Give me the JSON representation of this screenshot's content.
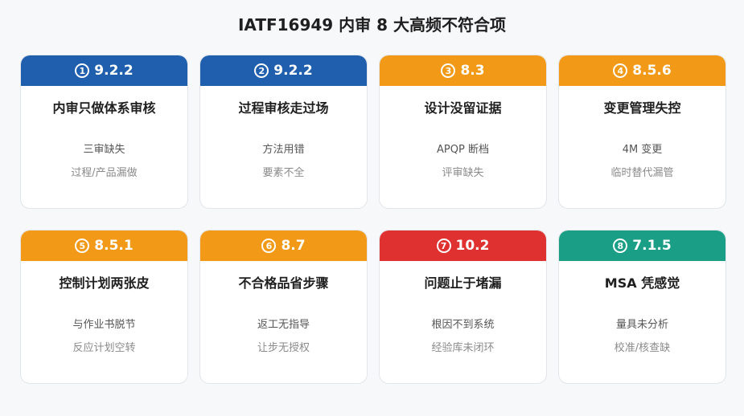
{
  "title": "IATF16949 内审 8 大高频不符合项",
  "colors": {
    "blue": "#1f5fae",
    "orange": "#f29a18",
    "red": "#e03131",
    "green": "#1a9e86"
  },
  "cards": [
    {
      "num": "1",
      "clause": "9.2.2",
      "color": "blue",
      "title": "内审只做体系审核",
      "line1": "三审缺失",
      "line2": "过程/产品漏做"
    },
    {
      "num": "2",
      "clause": "9.2.2",
      "color": "blue",
      "title": "过程审核走过场",
      "line1": "方法用错",
      "line2": "要素不全"
    },
    {
      "num": "3",
      "clause": "8.3",
      "color": "orange",
      "title": "设计没留证据",
      "line1": "APQP 断档",
      "line2": "评审缺失"
    },
    {
      "num": "4",
      "clause": "8.5.6",
      "color": "orange",
      "title": "变更管理失控",
      "line1": "4M 变更",
      "line2": "临时替代漏管"
    },
    {
      "num": "5",
      "clause": "8.5.1",
      "color": "orange",
      "title": "控制计划两张皮",
      "line1": "与作业书脱节",
      "line2": "反应计划空转"
    },
    {
      "num": "6",
      "clause": "8.7",
      "color": "orange",
      "title": "不合格品省步骤",
      "line1": "返工无指导",
      "line2": "让步无授权"
    },
    {
      "num": "7",
      "clause": "10.2",
      "color": "red",
      "title": "问题止于堵漏",
      "line1": "根因不到系统",
      "line2": "经验库未闭环"
    },
    {
      "num": "8",
      "clause": "7.1.5",
      "color": "green",
      "title": "MSA 凭感觉",
      "line1": "量具未分析",
      "line2": "校准/核查缺"
    }
  ]
}
